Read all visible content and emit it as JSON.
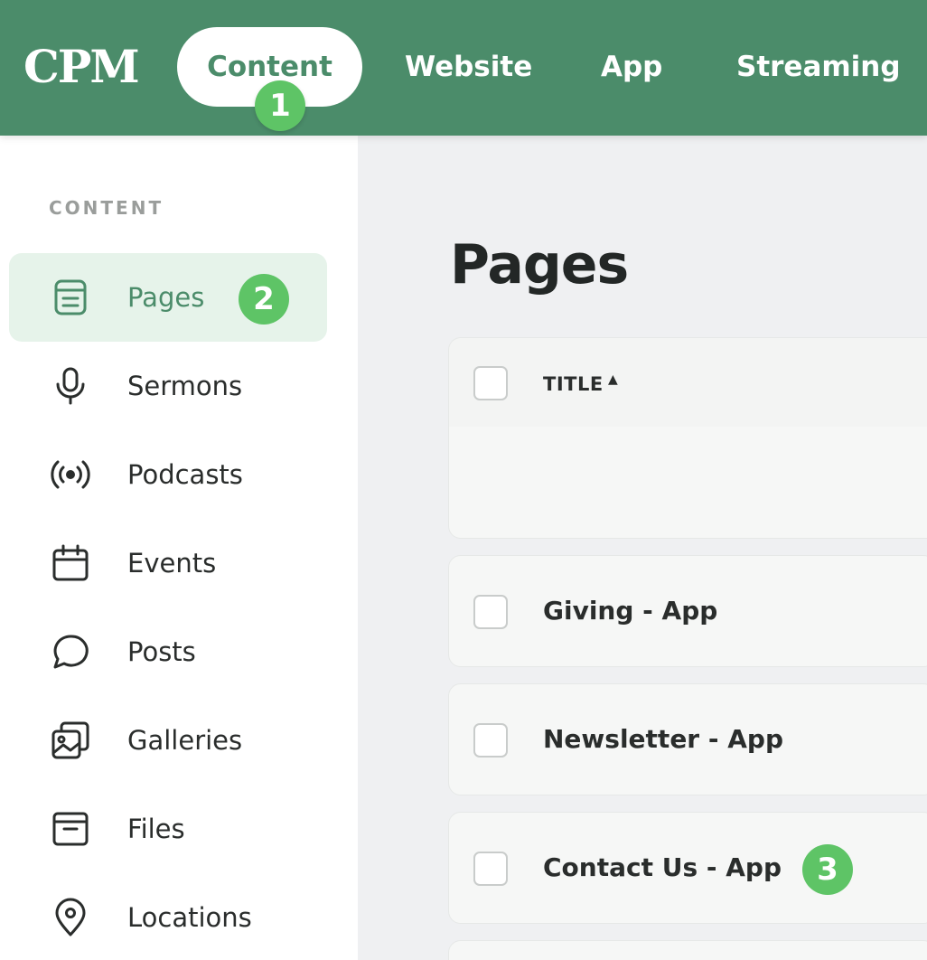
{
  "topbar": {
    "logo": "CPM",
    "tabs": [
      {
        "label": "Content",
        "active": true
      },
      {
        "label": "Website"
      },
      {
        "label": "App"
      },
      {
        "label": "Streaming"
      }
    ],
    "brand_color": "#4b8c6a"
  },
  "badges": {
    "one": "1",
    "two": "2",
    "three": "3"
  },
  "sidebar": {
    "section_label": "CONTENT",
    "items": [
      {
        "label": "Pages",
        "icon": "page-icon",
        "active": true
      },
      {
        "label": "Sermons",
        "icon": "microphone-icon"
      },
      {
        "label": "Podcasts",
        "icon": "broadcast-icon"
      },
      {
        "label": "Events",
        "icon": "calendar-icon"
      },
      {
        "label": "Posts",
        "icon": "chat-bubble-icon"
      },
      {
        "label": "Galleries",
        "icon": "gallery-icon"
      },
      {
        "label": "Files",
        "icon": "archive-icon"
      },
      {
        "label": "Locations",
        "icon": "map-pin-icon"
      }
    ]
  },
  "main": {
    "title": "Pages",
    "table": {
      "column_title": "TITLE",
      "sort_indicator": "▲",
      "rows": [
        {
          "title": ""
        },
        {
          "title": "Giving - App"
        },
        {
          "title": "Newsletter - App"
        },
        {
          "title": "Contact Us - App"
        }
      ]
    }
  }
}
